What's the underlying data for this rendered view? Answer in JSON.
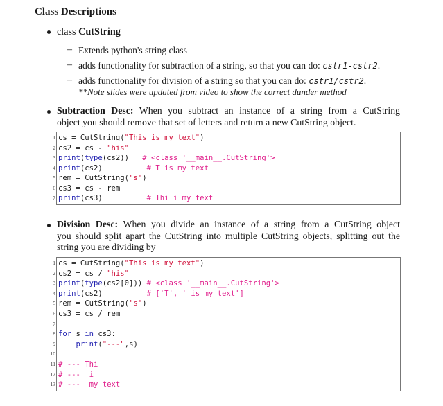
{
  "heading": "Class Descriptions",
  "class_item": {
    "prefix": "class",
    "name": "CutString",
    "sub_items": [
      {
        "text": "Extends python's string class"
      },
      {
        "text": "adds functionality for subtraction of a string, so that you can do:",
        "code": "cstr1-cstr2",
        "suffix": "."
      },
      {
        "text": "adds functionality for division of a string so that you can do:",
        "code": "cstr1/cstr2",
        "suffix": "."
      }
    ],
    "note": "**Note slides were updated from video to show the correct dunder method"
  },
  "subtraction": {
    "label": "Subtraction Desc:",
    "line1": "When you subtract an instance of a string from a CutString",
    "line2": "object you should remove that set of letters and return a new CutString object.",
    "code": [
      {
        "n": "1",
        "parts": [
          [
            "",
            "cs = CutString("
          ],
          [
            "str",
            "\"This is my text\""
          ],
          [
            "",
            ")"
          ]
        ]
      },
      {
        "n": "2",
        "parts": [
          [
            "",
            "cs2 = cs - "
          ],
          [
            "str",
            "\"his\""
          ]
        ]
      },
      {
        "n": "3",
        "parts": [
          [
            "kw",
            "print"
          ],
          [
            "",
            "("
          ],
          [
            "kw",
            "type"
          ],
          [
            "",
            "(cs2))   "
          ],
          [
            "cm",
            "# <class '__main__.CutString'>"
          ]
        ]
      },
      {
        "n": "4",
        "parts": [
          [
            "kw",
            "print"
          ],
          [
            "",
            "(cs2)          "
          ],
          [
            "cm",
            "# T is my text"
          ]
        ]
      },
      {
        "n": "5",
        "parts": [
          [
            "",
            "rem = CutString("
          ],
          [
            "str",
            "\"s\""
          ],
          [
            "",
            ")"
          ]
        ]
      },
      {
        "n": "6",
        "parts": [
          [
            "",
            "cs3 = cs - rem"
          ]
        ]
      },
      {
        "n": "7",
        "parts": [
          [
            "kw",
            "print"
          ],
          [
            "",
            "(cs3)          "
          ],
          [
            "cm",
            "# Thi i my text"
          ]
        ]
      }
    ]
  },
  "division": {
    "label": "Division Desc:",
    "line1": "When you divide an instance of a string from a CutString object",
    "line2": "you should split apart the CutString into multiple CutString objects, splitting out the",
    "line3": "string you are dividing by",
    "code": [
      {
        "n": "1",
        "parts": [
          [
            "",
            "cs = CutString("
          ],
          [
            "str",
            "\"This is my text\""
          ],
          [
            "",
            ")"
          ]
        ]
      },
      {
        "n": "2",
        "parts": [
          [
            "",
            "cs2 = cs / "
          ],
          [
            "str",
            "\"his\""
          ]
        ]
      },
      {
        "n": "3",
        "parts": [
          [
            "kw",
            "print"
          ],
          [
            "",
            "("
          ],
          [
            "kw",
            "type"
          ],
          [
            "",
            "(cs2[0])) "
          ],
          [
            "cm",
            "# <class '__main__.CutString'>"
          ]
        ]
      },
      {
        "n": "4",
        "parts": [
          [
            "kw",
            "print"
          ],
          [
            "",
            "(cs2)          "
          ],
          [
            "cm",
            "# ['T', ' is my text']"
          ]
        ]
      },
      {
        "n": "5",
        "parts": [
          [
            "",
            "rem = CutString("
          ],
          [
            "str",
            "\"s\""
          ],
          [
            "",
            ")"
          ]
        ]
      },
      {
        "n": "6",
        "parts": [
          [
            "",
            "cs3 = cs / rem"
          ]
        ]
      },
      {
        "n": "7",
        "parts": []
      },
      {
        "n": "8",
        "parts": [
          [
            "kw",
            "for"
          ],
          [
            "",
            " s "
          ],
          [
            "kw",
            "in"
          ],
          [
            "",
            " cs3:"
          ]
        ]
      },
      {
        "n": "9",
        "parts": [
          [
            "",
            "    "
          ],
          [
            "kw",
            "print"
          ],
          [
            "",
            "("
          ],
          [
            "str",
            "\"---\""
          ],
          [
            "",
            ",s)"
          ]
        ]
      },
      {
        "n": "10",
        "parts": []
      },
      {
        "n": "11",
        "parts": [
          [
            "cm",
            "# --- Thi"
          ]
        ]
      },
      {
        "n": "12",
        "parts": [
          [
            "cm",
            "# ---  i"
          ]
        ]
      },
      {
        "n": "13",
        "parts": [
          [
            "cm",
            "# ---  my text"
          ]
        ]
      }
    ]
  }
}
